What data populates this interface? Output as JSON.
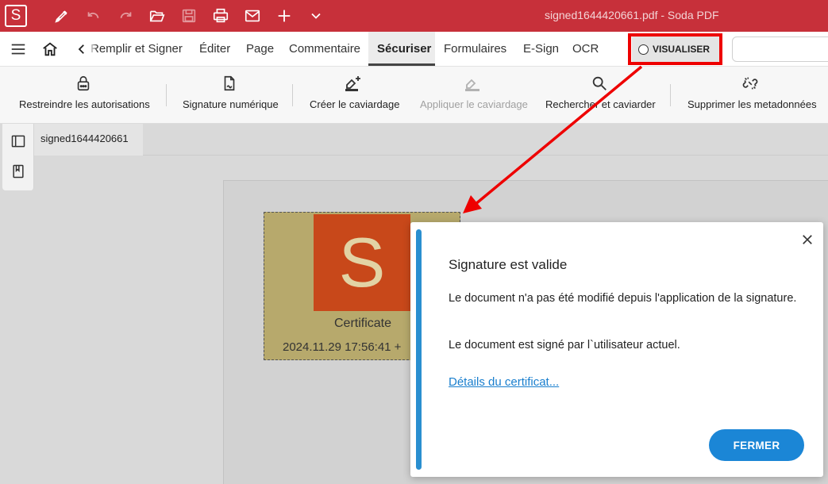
{
  "titlebar": {
    "logo": "S",
    "title": "signed1644420661.pdf  -  Soda PDF",
    "icons": [
      "pen-icon",
      "undo-icon",
      "redo-icon",
      "open-folder-icon",
      "save-icon",
      "print-icon",
      "mail-icon",
      "plus-icon",
      "chevron-down-icon"
    ]
  },
  "menu": {
    "items": [
      "Remplir et Signer",
      "Éditer",
      "Page",
      "Commentaire",
      "Sécuriser",
      "Formulaires",
      "E-Sign",
      "OCR"
    ],
    "active": "Sécuriser",
    "visualiser": "VISUALISER"
  },
  "toolbar": {
    "tools": [
      {
        "label": "Restreindre les autorisations",
        "icon": "lock-icon",
        "enabled": true
      },
      {
        "label": "Signature numérique",
        "icon": "signed-document-icon",
        "enabled": true
      },
      {
        "label": "Créer le caviardage",
        "icon": "eraser-plus-icon",
        "enabled": true
      },
      {
        "label": "Appliquer le caviardage",
        "icon": "eraser-icon",
        "enabled": false
      },
      {
        "label": "Rechercher et caviarder",
        "icon": "search-icon",
        "enabled": true
      },
      {
        "label": "Supprimer les metadonnées",
        "icon": "broken-link-icon",
        "enabled": true
      }
    ]
  },
  "sidepanel": {
    "icons": [
      "panel-icon",
      "bookmark-icon"
    ]
  },
  "document": {
    "tab": "signed1644420661",
    "signature": {
      "logo_letter": "S",
      "caption": "Certificate",
      "date": "2024.11.29 17:56:41 +"
    }
  },
  "dialog": {
    "title": "Signature est valide",
    "text1": "Le document n'a pas été modifié depuis l'application de la signature.",
    "text2": "Le document est signé par l`utilisateur actuel.",
    "link": "Détails du certificat...",
    "button": "FERMER"
  },
  "colors": {
    "titlebar": "#c7303a",
    "accent": "#1b86d6",
    "annotation": "#ee0000",
    "signature_bg": "#b7a96c",
    "signature_logo": "#c8481a"
  }
}
